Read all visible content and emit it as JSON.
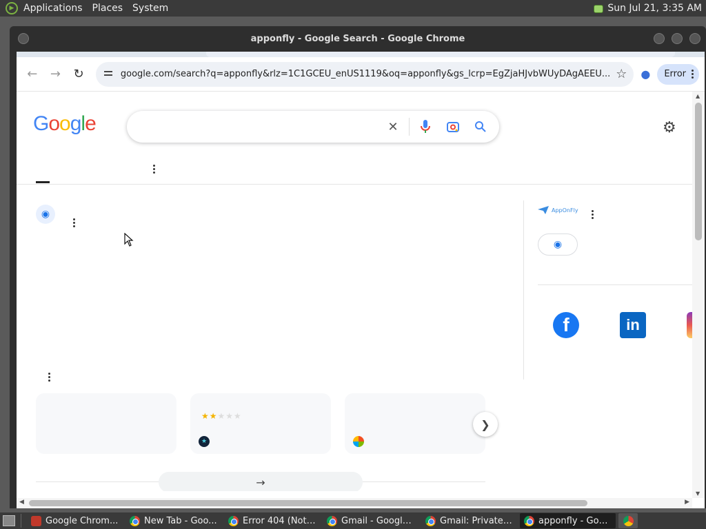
{
  "top_panel": {
    "menus": [
      "Applications",
      "Places",
      "System"
    ],
    "clock": "Sun Jul 21,  3:35 AM"
  },
  "window": {
    "title": "apponfly - Google Search - Google Chrome"
  },
  "toolbar": {
    "url": "google.com/search?q=apponfly&rlz=1C1GCEU_enUS1119&oq=apponfly&gs_lcrp=EgZjaHJvbWUyDAgAEEU...",
    "profile_status": "Error"
  },
  "page": {
    "logo_letters": [
      {
        "char": "G",
        "color": "#4285f4"
      },
      {
        "char": "o",
        "color": "#ea4335"
      },
      {
        "char": "o",
        "color": "#fbbc05"
      },
      {
        "char": "g",
        "color": "#4285f4"
      },
      {
        "char": "l",
        "color": "#34a853"
      },
      {
        "char": "e",
        "color": "#ea4335"
      }
    ],
    "knowledge_panel": {
      "brand_text": "AppOnFly"
    },
    "cards": [
      {
        "stars_on": 0,
        "icon": "none"
      },
      {
        "stars_on": 2,
        "stars_total": 5,
        "icon": "dark-star-icon"
      },
      {
        "stars_on": 0,
        "icon": "microsoft-icon"
      }
    ]
  },
  "taskbar": {
    "tasks": [
      {
        "label": "Google Chrom...",
        "icon": "red"
      },
      {
        "label": "New Tab - Goo...",
        "icon": "chrome"
      },
      {
        "label": "Error 404 (Not ...",
        "icon": "chrome"
      },
      {
        "label": "Gmail - Google ...",
        "icon": "chrome"
      },
      {
        "label": "Gmail: Private a...",
        "icon": "chrome"
      },
      {
        "label": "apponfly - Goo...",
        "icon": "chrome",
        "active": true
      }
    ]
  }
}
